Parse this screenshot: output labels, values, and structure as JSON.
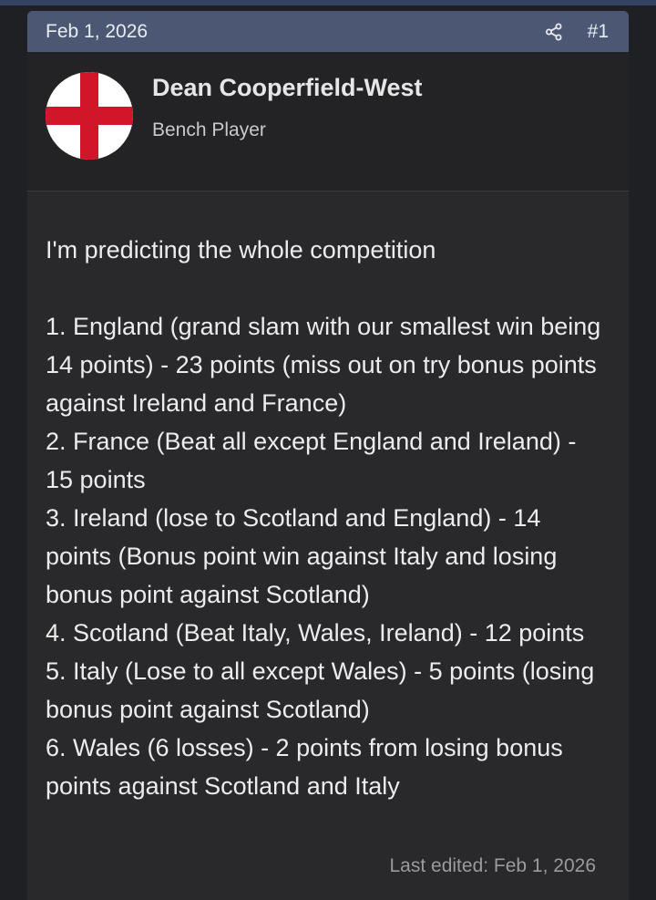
{
  "post": {
    "date": "Feb 1, 2026",
    "number": "#1",
    "share_icon": "share-icon",
    "author": {
      "name": "Dean Cooperfield-West",
      "title": "Bench Player",
      "avatar": "england-flag"
    },
    "body": {
      "intro": "I'm predicting the whole competition",
      "lines": [
        "1. England (grand slam with our smallest win being 14 points) - 23 points (miss out on try bonus points against Ireland and France)",
        "2. France (Beat all except England and Ireland) - 15 points",
        "3. Ireland (lose to Scotland and England) - 14 points (Bonus point win against Italy and losing bonus point against Scotland)",
        "4. Scotland (Beat Italy, Wales, Ireland) - 12 points",
        "5. Italy (Lose to all except Wales) - 5 points (losing bonus point against Scotland)",
        "6. Wales (6 losses) - 2 points from losing bonus points against Scotland and Italy"
      ]
    },
    "last_edited": "Last edited: Feb 1, 2026"
  },
  "colors": {
    "header_bg": "#4c5873",
    "post_bg": "#29292c",
    "user_block_bg": "#232326",
    "flag_red": "#d2162a"
  }
}
